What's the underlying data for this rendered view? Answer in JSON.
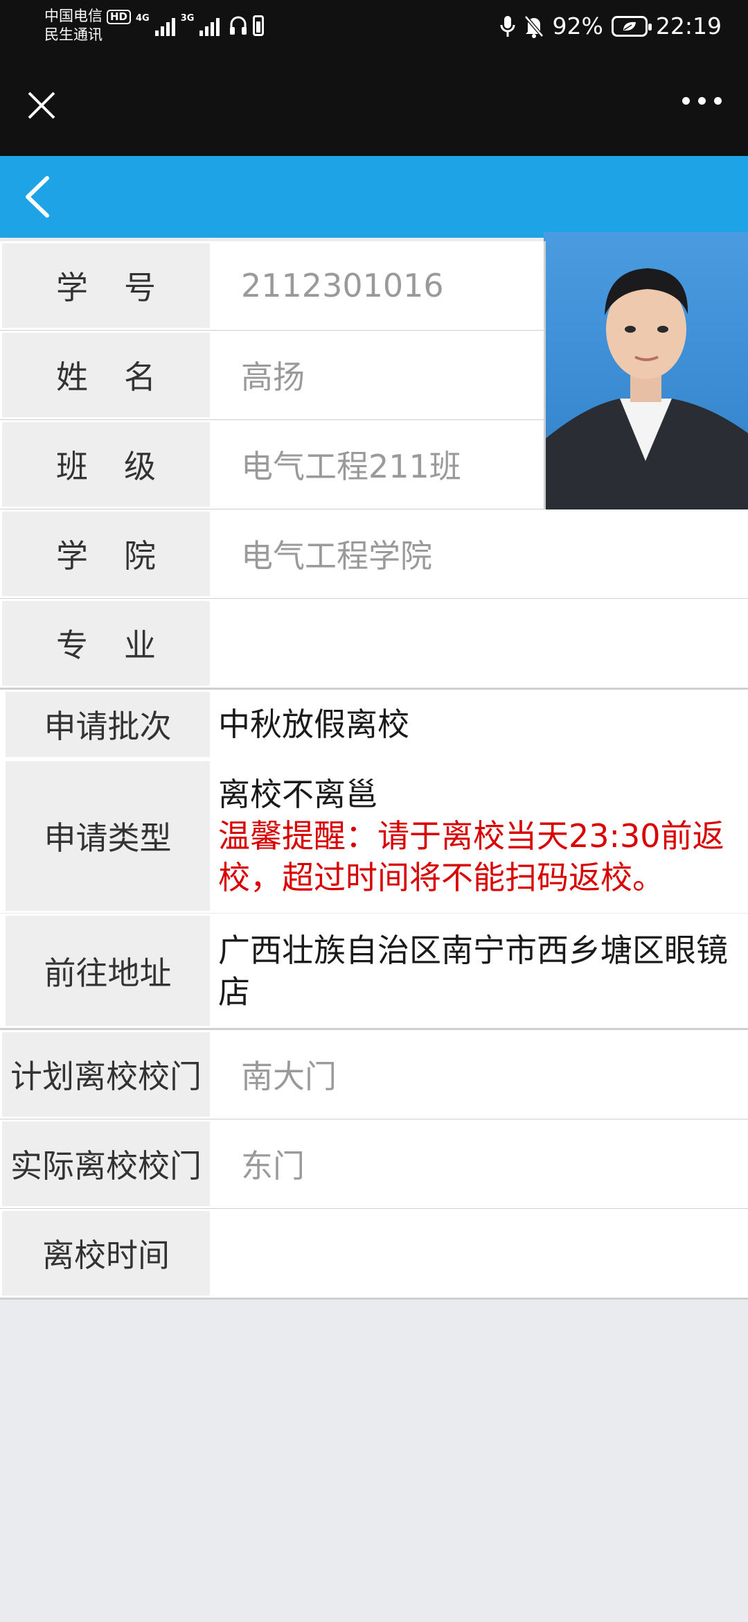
{
  "status_bar": {
    "carrier_line1": "中国电信",
    "hd_badge": "HD",
    "carrier_line2": "民生通讯",
    "network1": "4G",
    "network2": "3G",
    "battery_percent": "92%",
    "time": "22:19"
  },
  "form": {
    "student_id": {
      "label": "学号",
      "value": "2112301016"
    },
    "name": {
      "label": "姓名",
      "value": "高扬"
    },
    "class": {
      "label": "班级",
      "value": "电气工程211班"
    },
    "college": {
      "label": "学院",
      "value": "电气工程学院"
    },
    "major": {
      "label": "专业",
      "value": ""
    },
    "batch": {
      "label": "申请批次",
      "value": "中秋放假离校"
    },
    "type": {
      "label": "申请类型",
      "value": "离校不离邕",
      "reminder": "温馨提醒：请于离校当天23:30前返校，超过时间将不能扫码返校。"
    },
    "address": {
      "label": "前往地址",
      "value": "广西壮族自治区南宁市西乡塘区眼镜店"
    },
    "planned_gate": {
      "label": "计划离校校门",
      "value": "南大门"
    },
    "actual_gate": {
      "label": "实际离校校门",
      "value": "东门"
    },
    "leave_time": {
      "label": "离校时间",
      "value": ""
    }
  },
  "colors": {
    "nav_blue": "#1ea3e6",
    "reminder_red": "#d80000",
    "label_bg": "#eeeeee",
    "page_bg": "#e9ebef"
  }
}
